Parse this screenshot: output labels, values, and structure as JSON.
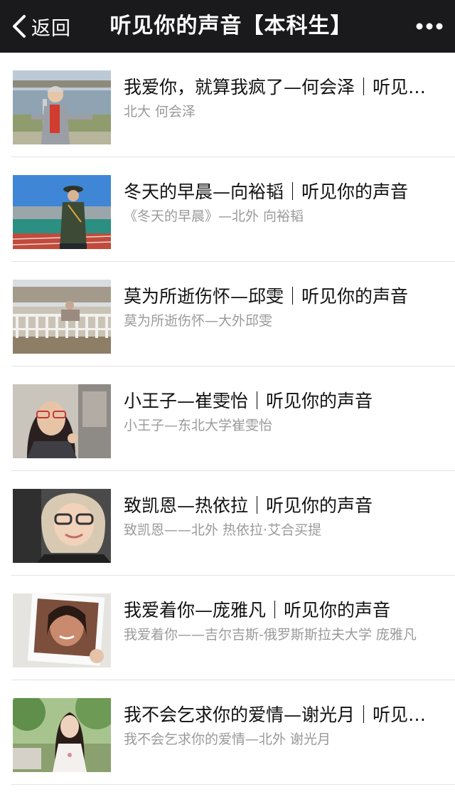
{
  "nav": {
    "back_label": "返回",
    "title": "听见你的声音【本科生】",
    "more_icon": "more-icon"
  },
  "articles": [
    {
      "title": "我爱你，就算我疯了—何会泽｜听见你的声音",
      "subtitle": "北大 何会泽",
      "thumb": "photo-woman-riverside"
    },
    {
      "title": "冬天的早晨—向裕韬｜听见你的声音",
      "subtitle": "《冬天的早晨》—北外 向裕韬",
      "thumb": "photo-uniform-track"
    },
    {
      "title": "莫为所逝伤怀—邱雯｜听见你的声音",
      "subtitle": "莫为所逝伤怀—大外邱雯",
      "thumb": "photo-balcony-railing"
    },
    {
      "title": "小王子—崔雯怡｜听见你的声音",
      "subtitle": "小王子—东北大学崔雯怡",
      "thumb": "photo-girl-glasses-heart"
    },
    {
      "title": "致凯恩—热依拉｜听见你的声音",
      "subtitle": "致凯恩——北外 热依拉·艾合买提",
      "thumb": "photo-girl-headscarf"
    },
    {
      "title": "我爱着你—庞雅凡｜听见你的声音",
      "subtitle": "我爱着你——吉尔吉斯-俄罗斯斯拉夫大学 庞雅凡",
      "thumb": "photo-polaroid-girl"
    },
    {
      "title": "我不会乞求你的爱情—谢光月｜听见你的声音",
      "subtitle": "我不会乞求你的爱情—北外 谢光月",
      "thumb": "photo-girl-garden"
    }
  ]
}
